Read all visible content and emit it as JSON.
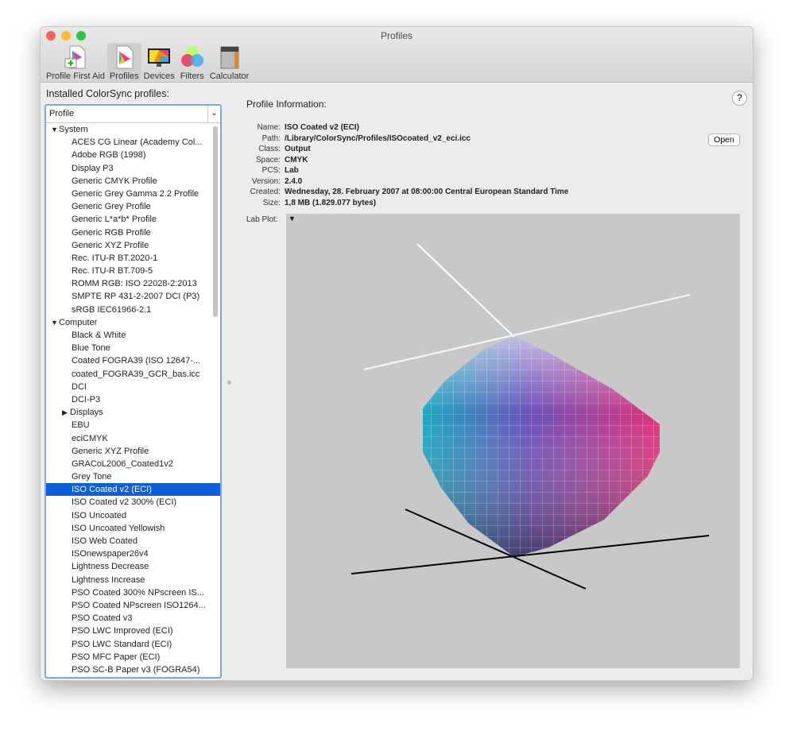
{
  "window": {
    "title": "Profiles"
  },
  "toolbar": {
    "items": [
      {
        "label": "Profile First Aid"
      },
      {
        "label": "Profiles",
        "selected": true
      },
      {
        "label": "Devices"
      },
      {
        "label": "Filters"
      },
      {
        "label": "Calculator"
      }
    ]
  },
  "sidebar": {
    "heading": "Installed ColorSync profiles:",
    "column_header": "Profile",
    "rows": [
      {
        "type": "grp",
        "label": "System",
        "expanded": true
      },
      {
        "type": "item",
        "label": "ACES CG Linear (Academy Col..."
      },
      {
        "type": "item",
        "label": "Adobe RGB (1998)"
      },
      {
        "type": "item",
        "label": "Display P3"
      },
      {
        "type": "item",
        "label": "Generic CMYK Profile"
      },
      {
        "type": "item",
        "label": "Generic Grey Gamma 2.2 Profile"
      },
      {
        "type": "item",
        "label": "Generic Grey Profile"
      },
      {
        "type": "item",
        "label": "Generic L*a*b* Profile"
      },
      {
        "type": "item",
        "label": "Generic RGB Profile"
      },
      {
        "type": "item",
        "label": "Generic XYZ Profile"
      },
      {
        "type": "item",
        "label": "Rec. ITU-R BT.2020-1"
      },
      {
        "type": "item",
        "label": "Rec. ITU-R BT.709-5"
      },
      {
        "type": "item",
        "label": "ROMM RGB: ISO 22028-2:2013"
      },
      {
        "type": "item",
        "label": "SMPTE RP 431-2-2007 DCI (P3)"
      },
      {
        "type": "item",
        "label": "sRGB IEC61966-2.1"
      },
      {
        "type": "grp",
        "label": "Computer",
        "expanded": true
      },
      {
        "type": "item",
        "label": "Black & White"
      },
      {
        "type": "item",
        "label": "Blue Tone"
      },
      {
        "type": "item",
        "label": "Coated FOGRA39 (ISO 12647-..."
      },
      {
        "type": "item",
        "label": "coated_FOGRA39_GCR_bas.icc"
      },
      {
        "type": "item",
        "label": "DCI"
      },
      {
        "type": "item",
        "label": "DCI-P3"
      },
      {
        "type": "sub",
        "label": "Displays",
        "expanded": false
      },
      {
        "type": "item",
        "label": "EBU"
      },
      {
        "type": "item",
        "label": "eciCMYK"
      },
      {
        "type": "item",
        "label": "Generic XYZ Profile"
      },
      {
        "type": "item",
        "label": "GRACoL2006_Coated1v2"
      },
      {
        "type": "item",
        "label": "Grey Tone"
      },
      {
        "type": "item",
        "label": "ISO Coated v2 (ECI)",
        "selected": true
      },
      {
        "type": "item",
        "label": "ISO Coated v2 300% (ECI)"
      },
      {
        "type": "item",
        "label": "ISO Uncoated"
      },
      {
        "type": "item",
        "label": "ISO Uncoated Yellowish"
      },
      {
        "type": "item",
        "label": "ISO Web Coated"
      },
      {
        "type": "item",
        "label": "ISOnewspaper26v4"
      },
      {
        "type": "item",
        "label": "Lightness Decrease"
      },
      {
        "type": "item",
        "label": "Lightness Increase"
      },
      {
        "type": "item",
        "label": "PSO Coated 300% NPscreen IS..."
      },
      {
        "type": "item",
        "label": "PSO Coated NPscreen ISO1264..."
      },
      {
        "type": "item",
        "label": "PSO Coated v3"
      },
      {
        "type": "item",
        "label": "PSO LWC Improved (ECI)"
      },
      {
        "type": "item",
        "label": "PSO LWC Standard (ECI)"
      },
      {
        "type": "item",
        "label": "PSO MFC Paper (ECI)"
      },
      {
        "type": "item",
        "label": "PSO SC-B Paper v3 (FOGRA54)"
      }
    ]
  },
  "info": {
    "heading": "Profile Information:",
    "help_label": "?",
    "open_label": "Open",
    "fields": [
      {
        "key": "Name:",
        "value": "ISO Coated v2 (ECI)"
      },
      {
        "key": "Path:",
        "value": "/Library/ColorSync/Profiles/ISOcoated_v2_eci.icc"
      },
      {
        "key": "Class:",
        "value": "Output"
      },
      {
        "key": "Space:",
        "value": "CMYK"
      },
      {
        "key": "PCS:",
        "value": "Lab"
      },
      {
        "key": "Version:",
        "value": "2.4.0"
      },
      {
        "key": "Created:",
        "value": "Wednesday, 28. February 2007 at 08:00:00 Central European Standard Time"
      },
      {
        "key": "Size:",
        "value": "1,8 MB (1.829.077 bytes)"
      }
    ],
    "lab_plot_label": "Lab Plot:",
    "lab_menu": "▼"
  },
  "colors": {
    "selection": "#0c5fd8",
    "focus_ring": "#7ea6ea",
    "plot_bg": "#c8c8c8"
  }
}
